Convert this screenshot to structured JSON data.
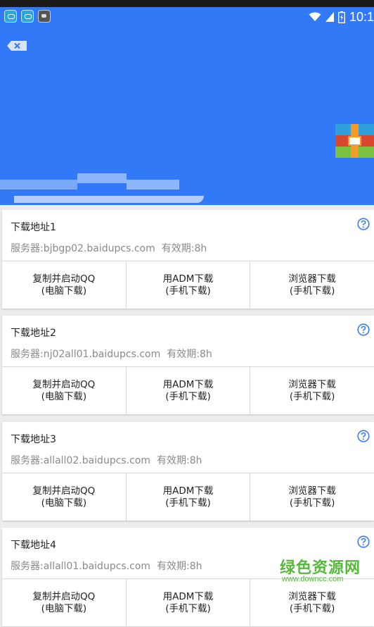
{
  "status_bar": {
    "notification_icons": [
      "cloud-app-icon",
      "cloud-app-icon",
      "robot-app-icon"
    ],
    "time": "10:1"
  },
  "header": {
    "background_color": "#3279f7",
    "close_icon": "close-icon",
    "gift_icon": "gift-icon"
  },
  "cards": [
    {
      "title": "下载地址1",
      "server": "服务器:bjbgp02.baidupcs.com",
      "expiry": "有效期:8h",
      "actions": [
        {
          "line1": "复制并启动QQ",
          "line2": "(电脑下载)"
        },
        {
          "line1": "用ADM下载",
          "line2": "(手机下载)"
        },
        {
          "line1": "浏览器下载",
          "line2": "(手机下载)"
        }
      ]
    },
    {
      "title": "下载地址2",
      "server": "服务器:nj02all01.baidupcs.com",
      "expiry": "有效期:8h",
      "actions": [
        {
          "line1": "复制并启动QQ",
          "line2": "(电脑下载)"
        },
        {
          "line1": "用ADM下载",
          "line2": "(手机下载)"
        },
        {
          "line1": "浏览器下载",
          "line2": "(手机下载)"
        }
      ]
    },
    {
      "title": "下载地址3",
      "server": "服务器:allall02.baidupcs.com",
      "expiry": "有效期:8h",
      "actions": [
        {
          "line1": "复制并启动QQ",
          "line2": "(电脑下载)"
        },
        {
          "line1": "用ADM下载",
          "line2": "(手机下载)"
        },
        {
          "line1": "浏览器下载",
          "line2": "(手机下载)"
        }
      ]
    },
    {
      "title": "下载地址4",
      "server": "服务器:allall01.baidupcs.com",
      "expiry": "有效期:8h",
      "actions": [
        {
          "line1": "复制并启动QQ",
          "line2": "(电脑下载)"
        },
        {
          "line1": "用ADM下载",
          "line2": "(手机下载)"
        },
        {
          "line1": "浏览器下载",
          "line2": "(手机下载)"
        }
      ]
    }
  ],
  "watermark": {
    "main": "绿色资源网",
    "url": "www.downcc.com",
    "color": "#55b93a"
  }
}
